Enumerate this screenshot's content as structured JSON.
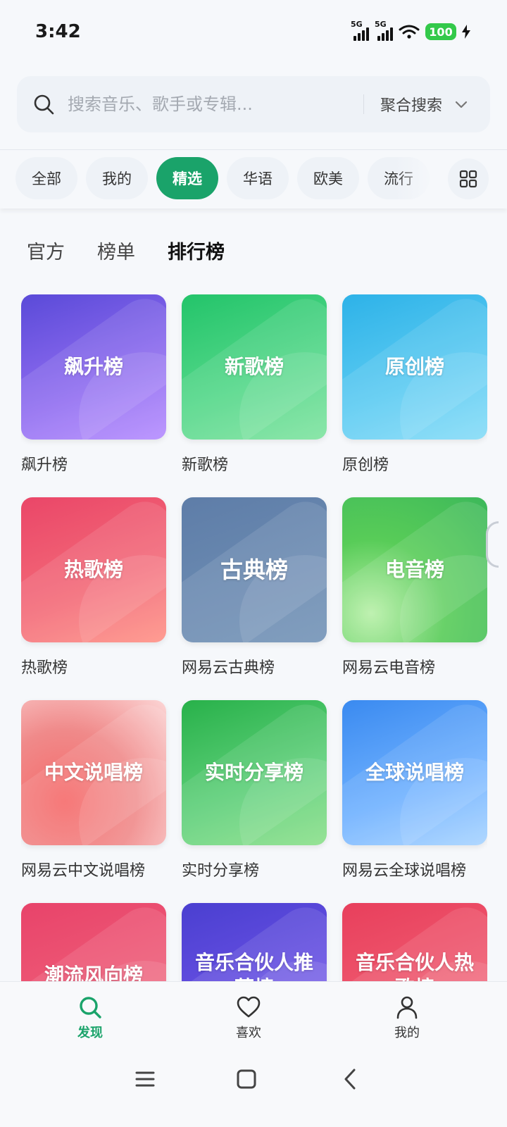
{
  "status_bar": {
    "time": "3:42",
    "signal_1": "5G",
    "signal_2": "5G",
    "battery": "100"
  },
  "search": {
    "placeholder": "搜索音乐、歌手或专辑...",
    "mode_label": "聚合搜索"
  },
  "categories": [
    "全部",
    "我的",
    "精选",
    "华语",
    "欧美",
    "流行"
  ],
  "active_category": "精选",
  "sub_tabs": [
    "官方",
    "榜单",
    "排行榜"
  ],
  "active_sub_tab": "排行榜",
  "charts": [
    {
      "cover": "飙升榜",
      "caption": "飙升榜"
    },
    {
      "cover": "新歌榜",
      "caption": "新歌榜"
    },
    {
      "cover": "原创榜",
      "caption": "原创榜"
    },
    {
      "cover": "热歌榜",
      "caption": "热歌榜"
    },
    {
      "cover": "古典榜",
      "caption": "网易云古典榜"
    },
    {
      "cover": "电音榜",
      "caption": "网易云电音榜"
    },
    {
      "cover": "中文说唱榜",
      "caption": "网易云中文说唱榜"
    },
    {
      "cover": "实时分享榜",
      "caption": "实时分享榜"
    },
    {
      "cover": "全球说唱榜",
      "caption": "网易云全球说唱榜"
    },
    {
      "cover": "潮流风向榜",
      "caption": ""
    },
    {
      "cover": "音乐合伙人推荐榜",
      "caption": ""
    },
    {
      "cover": "音乐合伙人热歌榜",
      "caption": ""
    }
  ],
  "bottom_nav": [
    {
      "label": "发现",
      "icon": "search-icon"
    },
    {
      "label": "喜欢",
      "icon": "heart-icon"
    },
    {
      "label": "我的",
      "icon": "user-icon"
    }
  ],
  "colors": {
    "accent": "#1aa36a",
    "background": "#f6f8fb",
    "chip": "#eef2f7"
  }
}
